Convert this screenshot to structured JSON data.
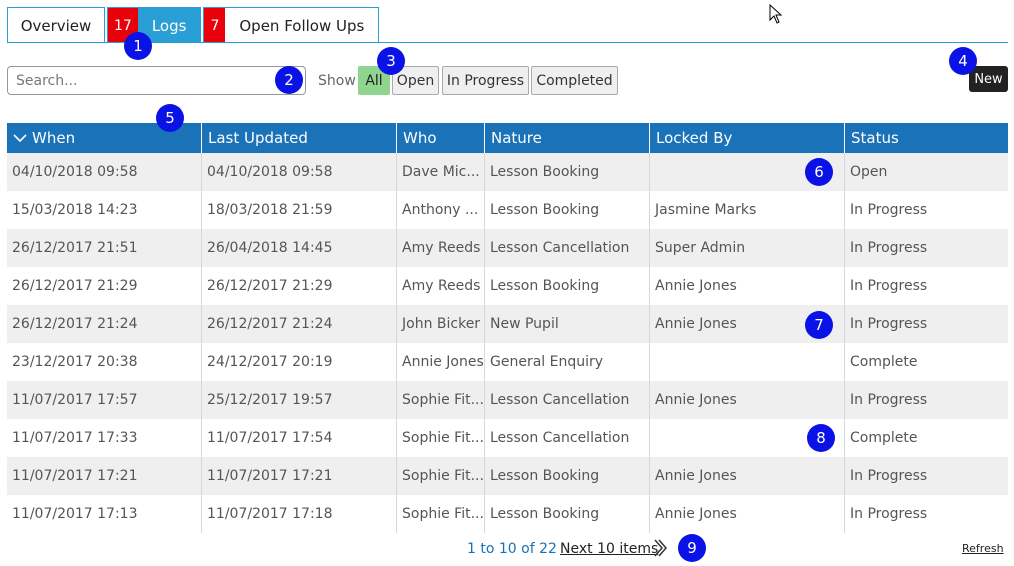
{
  "tabs": [
    {
      "label": "Overview",
      "count": null,
      "active": false
    },
    {
      "label": "Logs",
      "count": "17",
      "active": true
    },
    {
      "label": "Open Follow Ups",
      "count": "7",
      "active": false
    }
  ],
  "search": {
    "placeholder": "Search...",
    "value": ""
  },
  "filter": {
    "label": "Show",
    "options": [
      "All",
      "Open",
      "In Progress",
      "Completed"
    ],
    "selected": "All"
  },
  "new_button": "New",
  "table": {
    "sort_icon": "chevron-down-icon",
    "columns": [
      "When",
      "Last Updated",
      "Who",
      "Nature",
      "Locked By",
      "Status"
    ],
    "rows": [
      [
        "04/10/2018 09:58",
        "04/10/2018 09:58",
        "Dave Mic...",
        "Lesson Booking",
        "",
        "Open"
      ],
      [
        "15/03/2018 14:23",
        "18/03/2018 21:59",
        "Anthony ...",
        "Lesson Booking",
        "Jasmine Marks",
        "In Progress"
      ],
      [
        "26/12/2017 21:51",
        "26/04/2018 14:45",
        "Amy Reeds",
        "Lesson Cancellation",
        "Super Admin",
        "In Progress"
      ],
      [
        "26/12/2017 21:29",
        "26/12/2017 21:29",
        "Amy Reeds",
        "Lesson Booking",
        "Annie Jones",
        "In Progress"
      ],
      [
        "26/12/2017 21:24",
        "26/12/2017 21:24",
        "John Bicker",
        "New Pupil",
        "Annie Jones",
        "In Progress"
      ],
      [
        "23/12/2017 20:38",
        "24/12/2017 20:19",
        "Annie Jones",
        "General Enquiry",
        "",
        "Complete"
      ],
      [
        "11/07/2017 17:57",
        "25/12/2017 19:57",
        "Sophie Fit...",
        "Lesson Cancellation",
        "Annie Jones",
        "In Progress"
      ],
      [
        "11/07/2017 17:33",
        "11/07/2017 17:54",
        "Sophie Fit...",
        "Lesson Cancellation",
        "",
        "Complete"
      ],
      [
        "11/07/2017 17:21",
        "11/07/2017 17:21",
        "Sophie Fit...",
        "Lesson Booking",
        "Annie Jones",
        "In Progress"
      ],
      [
        "11/07/2017 17:13",
        "11/07/2017 17:18",
        "Sophie Fit...",
        "Lesson Booking",
        "Annie Jones",
        "In Progress"
      ]
    ]
  },
  "pager": {
    "info": "1 to 10 of 22",
    "next": "Next 10 items",
    "next_icon": "double-chevron-right-icon"
  },
  "refresh": "Refresh",
  "markers": [
    "1",
    "2",
    "3",
    "4",
    "5",
    "6",
    "7",
    "8",
    "9"
  ],
  "colors": {
    "accent": "#2a9fd6",
    "header": "#1a72b8",
    "badge": "#e8000b",
    "selected_filter": "#8fd58f",
    "marker": "#0a12e6"
  }
}
